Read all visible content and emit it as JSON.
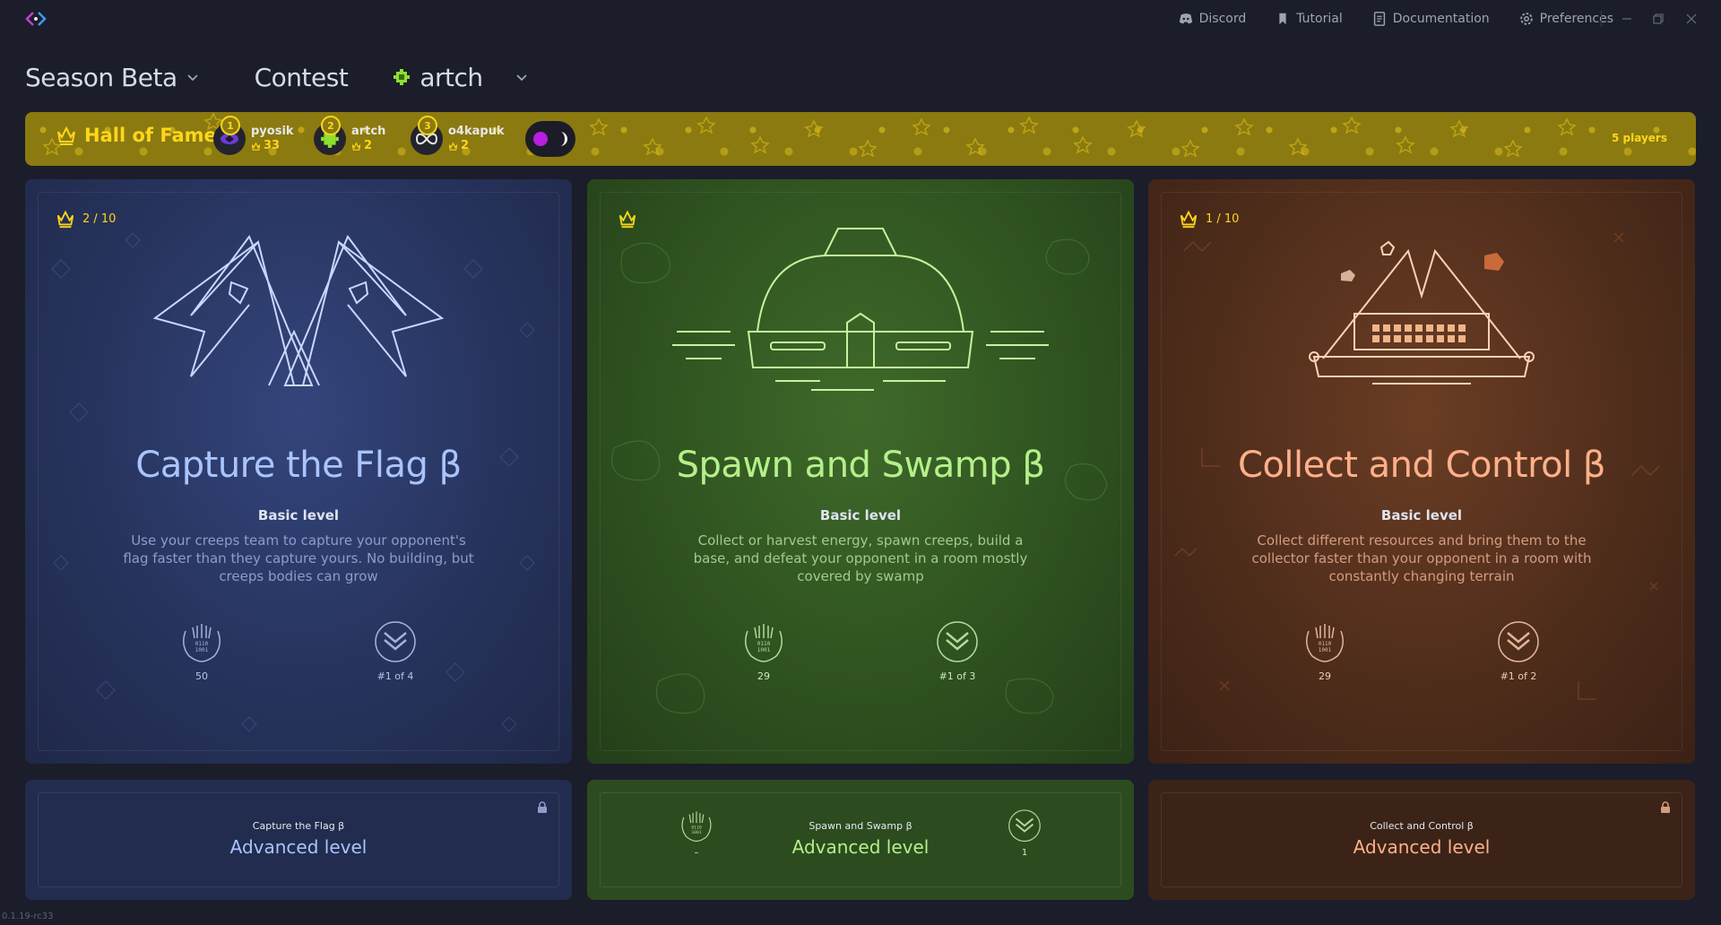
{
  "titlebar": {
    "links": [
      {
        "label": "Discord",
        "icon": "discord-icon"
      },
      {
        "label": "Tutorial",
        "icon": "bookmark-icon"
      },
      {
        "label": "Documentation",
        "icon": "document-icon"
      },
      {
        "label": "Preferences",
        "icon": "gear-icon"
      }
    ]
  },
  "nav": {
    "season": "Season Beta",
    "contest": "Contest",
    "user": "artch"
  },
  "hall_of_fame": {
    "title": "Hall of Fame",
    "players": [
      {
        "rank": "1",
        "name": "pyosik",
        "score": "33"
      },
      {
        "rank": "2",
        "name": "artch",
        "score": "2"
      },
      {
        "rank": "3",
        "name": "o4kapuk",
        "score": "2"
      }
    ],
    "count": "5 players"
  },
  "cards": [
    {
      "badge": "2 / 10",
      "title": "Capture the Flag β",
      "level": "Basic level",
      "description": "Use your creeps team to capture your opponent's flag faster than they capture yours. No building, but creeps bodies can grow",
      "stat_left": "50",
      "stat_right": "#1 of 4"
    },
    {
      "badge": "",
      "title": "Spawn and Swamp β",
      "level": "Basic level",
      "description": "Collect or harvest energy, spawn creeps, build a base, and defeat your opponent in a room mostly covered by swamp",
      "stat_left": "29",
      "stat_right": "#1 of 3"
    },
    {
      "badge": "1 / 10",
      "title": "Collect and Control β",
      "level": "Basic level",
      "description": "Collect different resources and bring them to the collector faster than your opponent in a room with constantly changing terrain",
      "stat_left": "29",
      "stat_right": "#1 of 2"
    }
  ],
  "advanced": [
    {
      "subtitle": "Capture the Flag β",
      "title": "Advanced level",
      "locked": true
    },
    {
      "subtitle": "Spawn and Swamp β",
      "title": "Advanced level",
      "locked": false,
      "stat_left": "–",
      "stat_right": "1"
    },
    {
      "subtitle": "Collect and Control β",
      "title": "Advanced level",
      "locked": true
    }
  ],
  "version": "0.1.19-rc33",
  "colors": {
    "blue_title": "#a9c4ff",
    "green_title": "#b4f08a",
    "orange_title": "#ffb08a",
    "gold": "#ffd61a"
  }
}
